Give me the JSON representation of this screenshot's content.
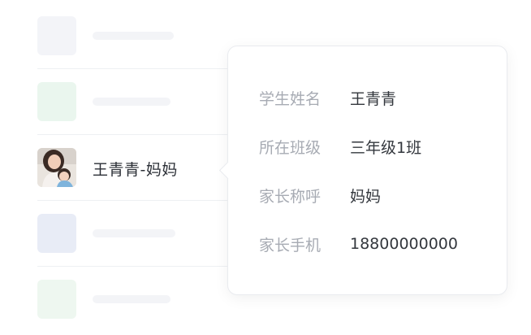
{
  "contact_list": {
    "active_contact": {
      "name": "王青青-妈妈",
      "avatar_icon": "mother-child-photo-avatar"
    },
    "placeholder_colors": [
      "#f3f4f8",
      "#eaf6ee",
      "#e8ecf6",
      "#eef7f0"
    ]
  },
  "detail_popover": {
    "fields": [
      {
        "label": "学生姓名",
        "value": "王青青"
      },
      {
        "label": "所在班级",
        "value": "三年级1班"
      },
      {
        "label": "家长称呼",
        "value": "妈妈"
      },
      {
        "label": "家长手机",
        "value": "18800000000"
      }
    ]
  }
}
